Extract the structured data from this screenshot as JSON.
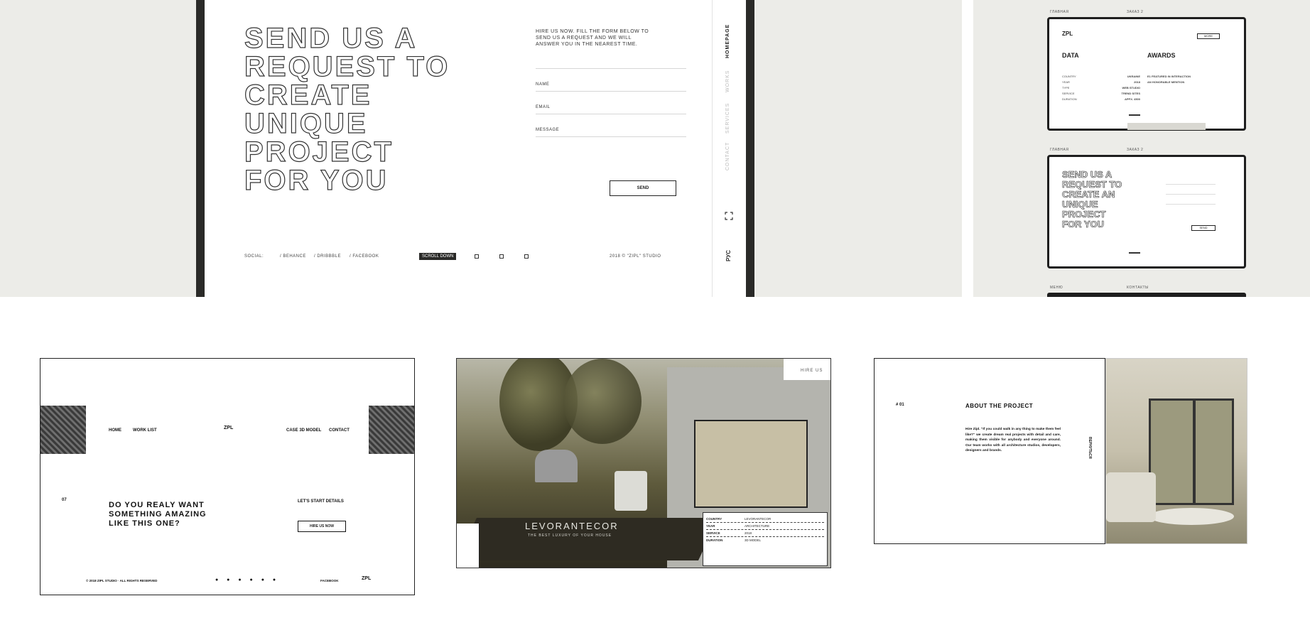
{
  "contact": {
    "title_lines": [
      "SEND US A",
      "REQUEST TO",
      "CREATE",
      "UNIQUE",
      "PROJECT",
      "FOR YOU"
    ],
    "intro": "HIRE US NOW. FILL THE FORM BELOW TO SEND US A REQUEST AND WE WILL ANSWER YOU IN THE NEAREST TIME.",
    "fields": [
      "NAME",
      "EMAIL",
      "MESSAGE"
    ],
    "send": "SEND",
    "social_label": "SOCIAL:",
    "social": [
      "/ BEHANCE",
      "/ DRIBBBLE",
      "/ FACEBOOK"
    ],
    "scroll": "SCROLL DOWN",
    "copyright": "2018 © \"ZIPL\" STUDIO",
    "nav": [
      "HOMEPAGE",
      "WORKS",
      "SERVICES",
      "CONTACT"
    ],
    "lang": "РУС"
  },
  "mini1": {
    "label_left": "ГЛАВНАЯ",
    "label_right": "ЗАКАЗ 2",
    "logo": "ZPL",
    "btn": "MORE",
    "data_title": "DATA",
    "awards_title": "AWARDS",
    "rows": [
      [
        "COUNTRY",
        "UKRAINE"
      ],
      [
        "YEAR",
        "2018"
      ],
      [
        "TYPE",
        "WEB STUDIO"
      ],
      [
        "SERVICE",
        "TREND SITES"
      ],
      [
        "DURATION",
        "APPX. 4500"
      ]
    ],
    "awards": [
      "E1 FEATURED IN INTERACTION",
      "AN HONORABLE MENTION"
    ]
  },
  "mini2": {
    "label_left": "ГЛАВНАЯ",
    "label_right": "ЗАКАЗ 2",
    "title_lines": [
      "SEND US A",
      "REQUEST TO",
      "CREATE AN",
      "UNIQUE",
      "PROJECT",
      "FOR YOU"
    ],
    "btn": "SEND",
    "label_bottom_left": "МЕНЮ",
    "label_bottom_right": "КОНТАКТЫ"
  },
  "card1": {
    "nav_left": [
      "HOME",
      "WORK LIST"
    ],
    "logo": "ZPL",
    "nav_right": [
      "CASE 3D MODEL",
      "CONTACT"
    ],
    "num": "07",
    "headline": [
      "DO YOU REALY WANT",
      "SOMETHING AMAZING",
      "LIKE THIS ONE?"
    ],
    "cta_label": "LET'S START DETAILS",
    "cta": "HIRE US NOW",
    "footer_left": "© 2018 ZIPL STUDIO · ALL RIGHTS RESERVED",
    "footer_right": "FACEBOOK"
  },
  "card2": {
    "hire": "HIRE US",
    "title": "LEVORANTECOR",
    "subtitle": "THE BEST LUXURY OF YOUR HOUSE",
    "table": [
      [
        "COUNTRY",
        "LEVORANTECOR"
      ],
      [
        "YEAR",
        "ARCHITECTURE"
      ],
      [
        "SERVICE",
        "2018"
      ],
      [
        "DURATION",
        "3D MODEL"
      ]
    ]
  },
  "card3": {
    "num": "# 01",
    "heading": "ABOUT THE PROJECT",
    "body": "Hire Zipl. \"If you could walk in any thing to make them feel like?\" we create dream real projects with detail and care, making them visible for anybody and everyone around. Our team works with all architecture studios, developers, designers and brands.",
    "side": "ВЕРНУТЬСЯ"
  }
}
